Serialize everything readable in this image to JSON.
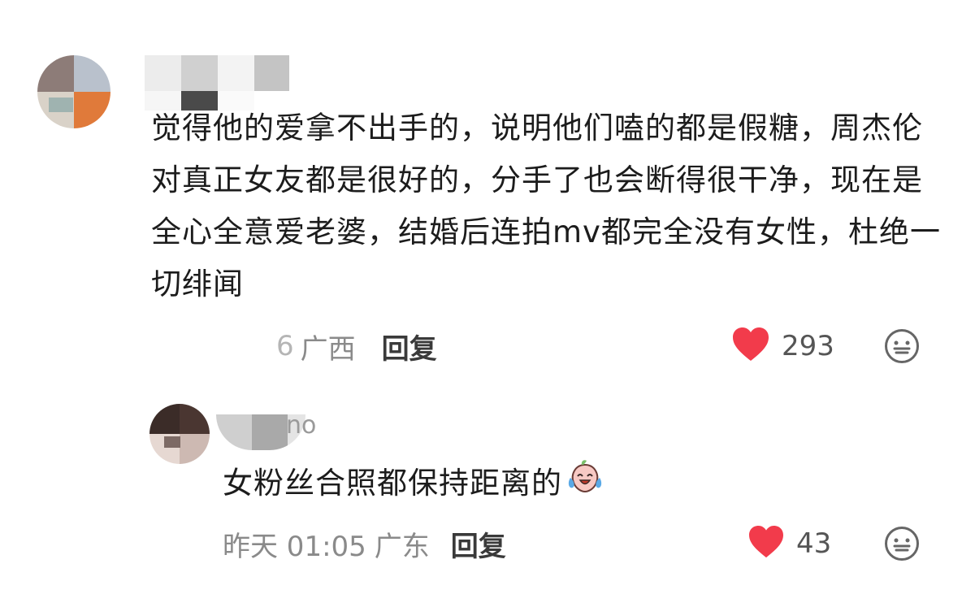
{
  "main_comment": {
    "text": "觉得他的爱拿不出手的，说明他们嗑的都是假糖，周杰伦对真正女友都是很好的，分手了也会断得很干净，现在是全心全意爱老婆，结婚后连拍mv都完全没有女性，杜绝一切绯闻",
    "time_partial": "6",
    "location": "广西",
    "reply_label": "回复",
    "like_count": "293"
  },
  "reply_comment": {
    "author_visible": "no",
    "text": "女粉丝合照都保持距离的",
    "time": "昨天 01:05",
    "location": "广东",
    "reply_label": "回复",
    "like_count": "43"
  },
  "colors": {
    "heart": "#f23b4b",
    "meta": "#8a8a8a",
    "text": "#1c1c1c"
  },
  "icons": {
    "like": "heart-icon",
    "react": "neutral-face-icon",
    "inline_emoji": "crying-laugh-emoji"
  }
}
